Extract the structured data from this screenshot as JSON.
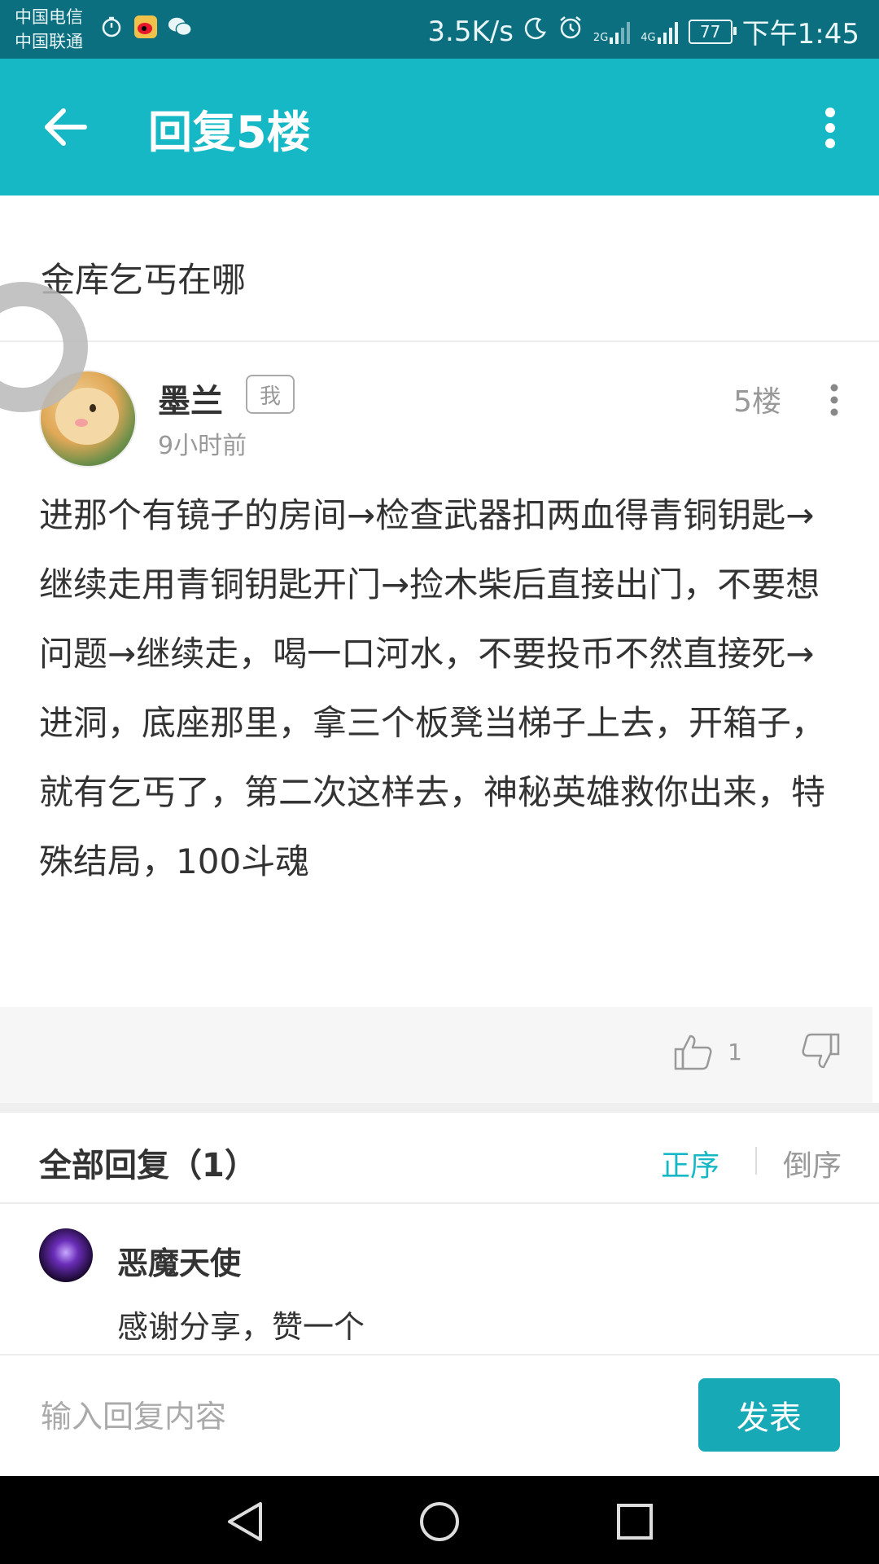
{
  "status_bar": {
    "carrier1": "中国电信",
    "carrier2": "中国联通",
    "speed": "3.5K/s",
    "signal1_label": "2G",
    "signal2_label": "4G",
    "battery": "77",
    "time": "下午1:45"
  },
  "app_bar": {
    "title": "回复5楼"
  },
  "topic": {
    "title": "金库乞丐在哪"
  },
  "post": {
    "username": "墨兰",
    "me_badge": "我",
    "time": "9小时前",
    "floor": "5楼",
    "content": "进那个有镜子的房间→检查武器扣两血得青铜钥匙→继续走用青铜钥匙开门→捡木柴后直接出门，不要想问题→继续走，喝一口河水，不要投币不然直接死→进洞，底座那里，拿三个板凳当梯子上去，开箱子，就有乞丐了，第二次这样去，神秘英雄救你出来，特殊结局，100斗魂",
    "like_count": "1"
  },
  "replies": {
    "header": "全部回复（1）",
    "sort_asc": "正序",
    "sort_desc": "倒序",
    "items": [
      {
        "username": "恶魔天使",
        "text": "感谢分享，赞一个"
      }
    ]
  },
  "input": {
    "placeholder": "输入回复内容",
    "send_label": "发表"
  },
  "colors": {
    "accent": "#17b8c6",
    "status_bar": "#0b6f80",
    "send_button": "#17a9b5"
  }
}
